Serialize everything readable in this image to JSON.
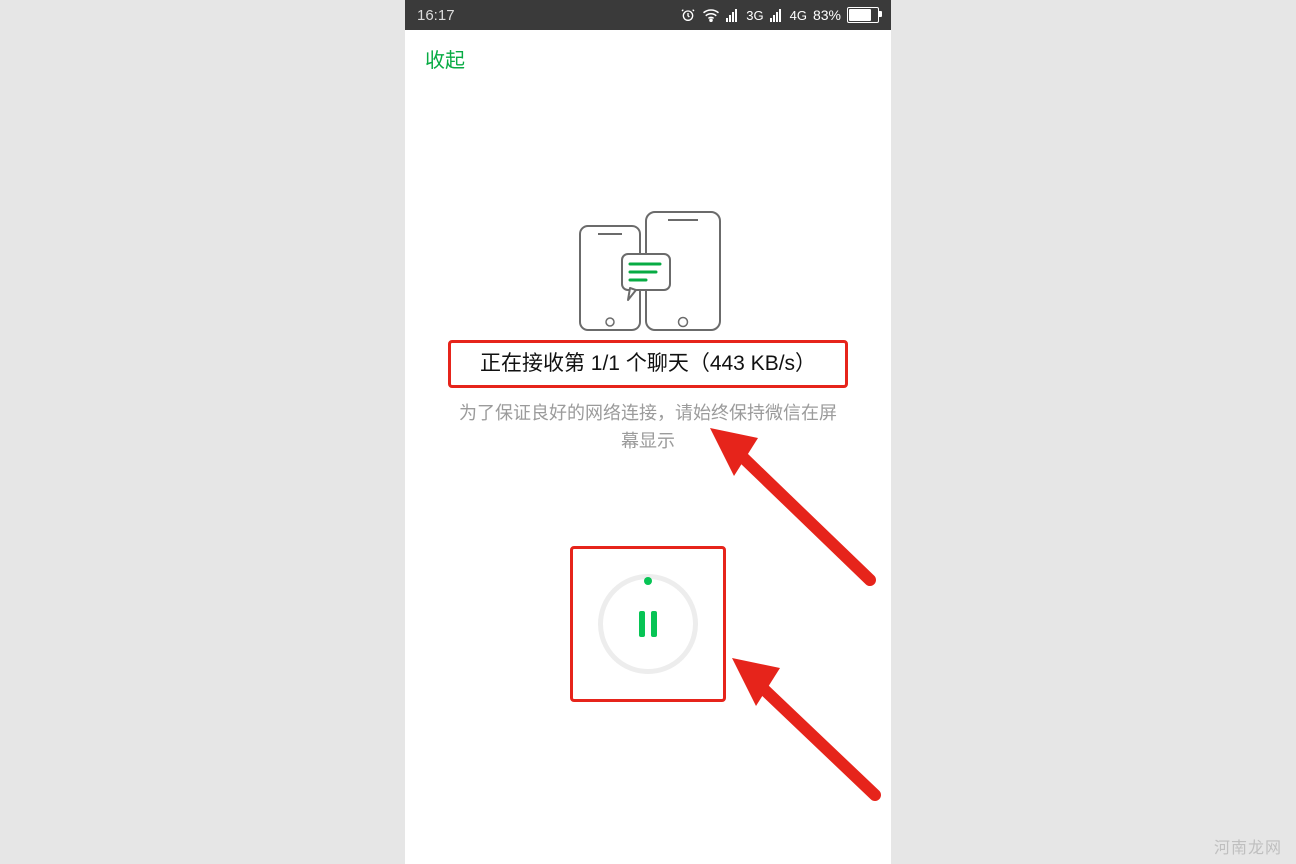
{
  "status_bar": {
    "time": "16:17",
    "network1": "3G",
    "network2": "4G",
    "battery_pct": "83%",
    "battery_fill": 83
  },
  "header": {
    "collapse_label": "收起"
  },
  "transfer": {
    "status_text": "正在接收第 1/1 个聊天（443 KB/s）",
    "hint_text": "为了保证良好的网络连接，请始终保持微信在屏幕显示"
  },
  "watermark": "河南龙网"
}
